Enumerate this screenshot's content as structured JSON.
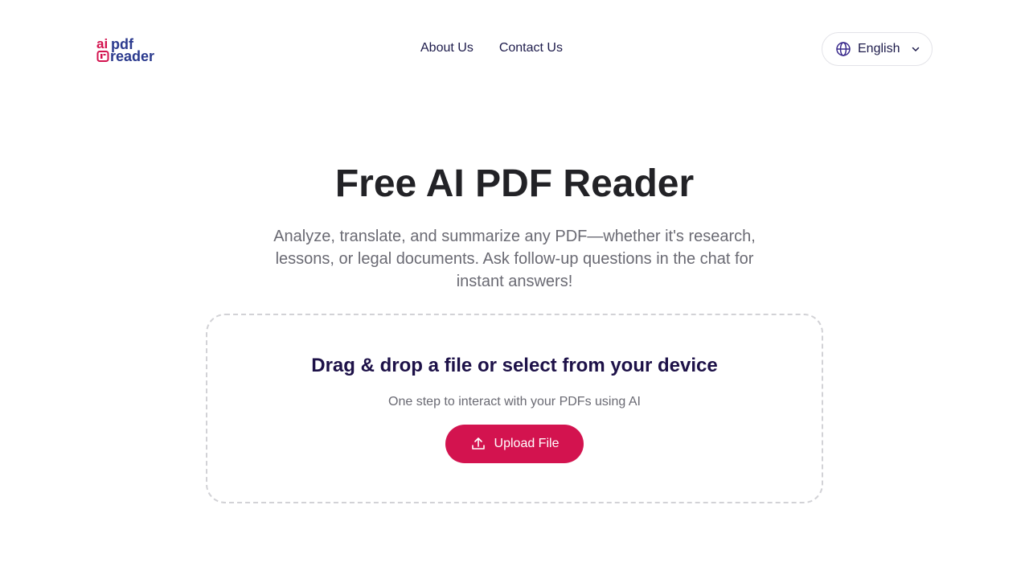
{
  "header": {
    "logo": {
      "text_top_left": "ai",
      "text_top_right": "pdf",
      "text_bottom": "reader",
      "icon": "document-icon"
    },
    "nav": [
      {
        "label": "About Us"
      },
      {
        "label": "Contact Us"
      }
    ],
    "language": {
      "label": "English",
      "icon": "globe-icon",
      "chevron": "chevron-down-icon"
    }
  },
  "hero": {
    "title": "Free AI PDF Reader",
    "subtitle": "Analyze, translate, and summarize any PDF—whether it's research, lessons, or legal documents. Ask follow-up questions in the chat for instant answers!"
  },
  "dropzone": {
    "title": "Drag & drop a file or select from your device",
    "subtitle": "One step to interact with your PDFs using AI",
    "button_label": "Upload File",
    "button_icon": "upload-icon"
  },
  "colors": {
    "brand_pink": "#d3134f",
    "brand_navy": "#2b3a8e",
    "heading_dark": "#1d1148",
    "muted_text": "#6a6a73"
  }
}
